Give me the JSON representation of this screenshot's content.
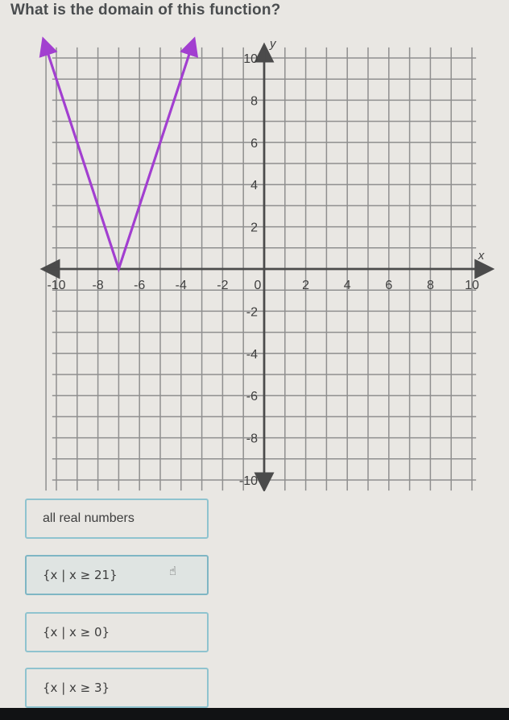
{
  "question": "What is the domain of this function?",
  "chart_data": {
    "type": "line",
    "title": "",
    "function": "y = 3|x + 7|",
    "series": [
      {
        "name": "absolute value function",
        "color": "#a23fd0",
        "points": [
          [
            -10.6,
            10.8
          ],
          [
            -7,
            0
          ],
          [
            -3.4,
            10.8
          ]
        ],
        "arrows": [
          "start",
          "end"
        ]
      }
    ],
    "vertex": [
      -7,
      0
    ],
    "xlabel": "x",
    "ylabel": "y",
    "xlim": [
      -10,
      10
    ],
    "ylim": [
      -10,
      10
    ],
    "xticks": [
      -10,
      -8,
      -6,
      -4,
      -2,
      0,
      2,
      4,
      6,
      8,
      10
    ],
    "yticks": [
      10,
      8,
      6,
      4,
      2,
      -2,
      -4,
      -6,
      -8,
      -10
    ],
    "grid": true,
    "grid_step": 1
  },
  "options": [
    {
      "label": "all real numbers",
      "state": "default"
    },
    {
      "label": "{x | x ≥ 21}",
      "state": "hovered"
    },
    {
      "label": "{x | x ≥ 0}",
      "state": "default"
    },
    {
      "label": "{x | x ≥ 3}",
      "state": "default"
    }
  ],
  "cursor": "hand-pointer-icon"
}
